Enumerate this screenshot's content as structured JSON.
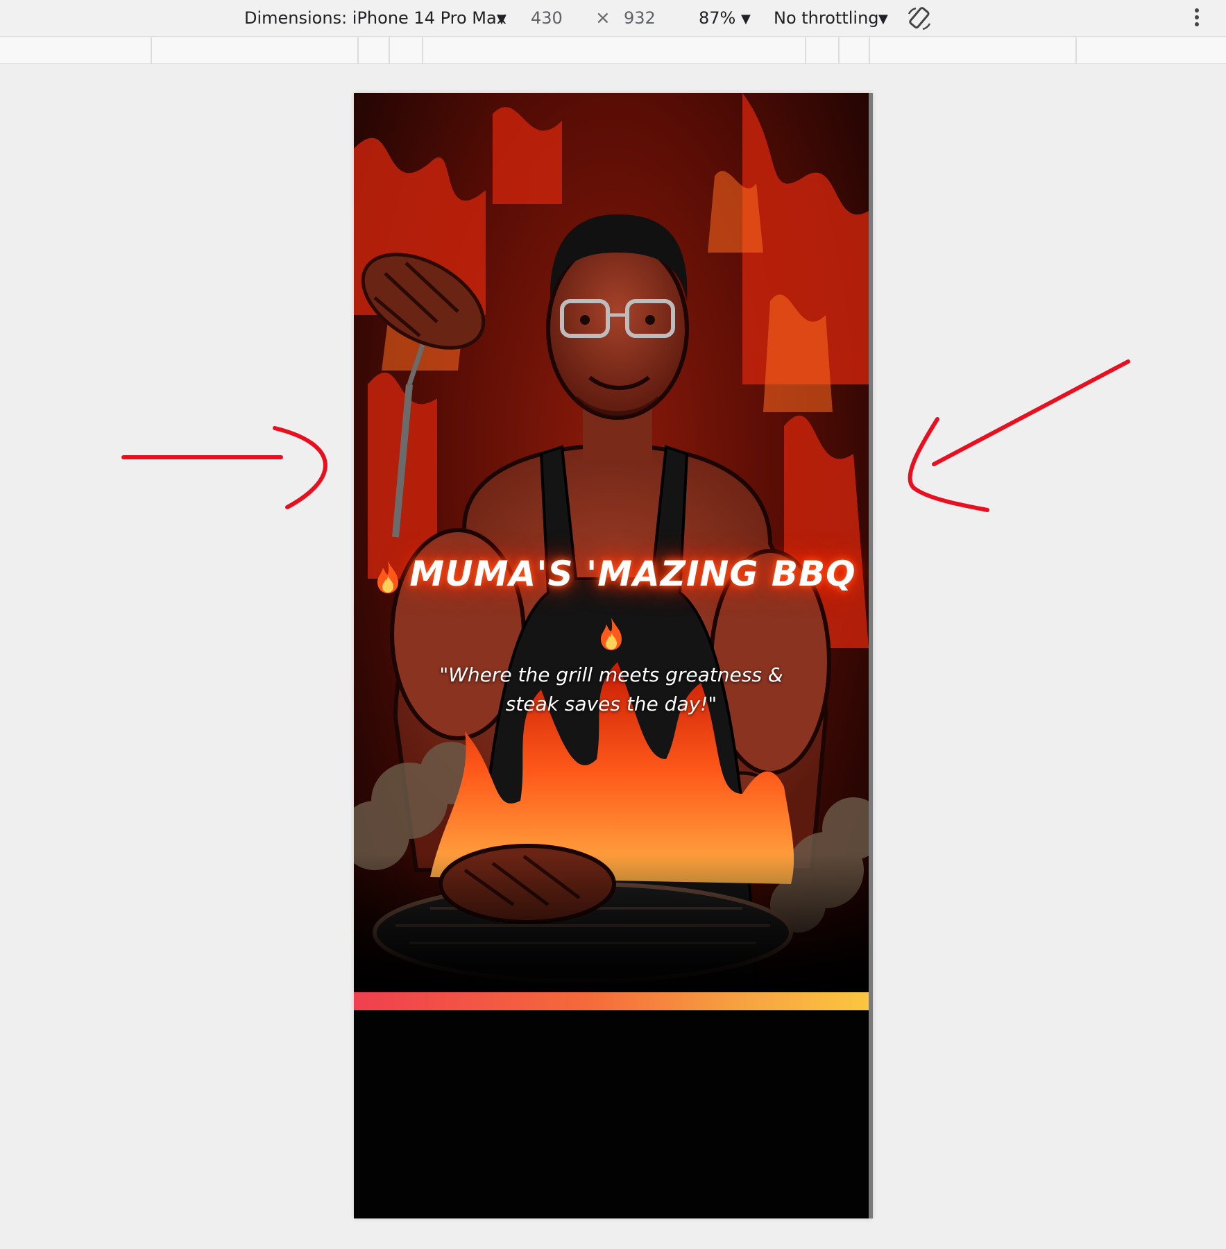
{
  "devtools": {
    "dimensions_label": "Dimensions: iPhone 14 Pro Max",
    "width": "430",
    "times": "×",
    "height": "932",
    "zoom": "87%",
    "throttling": "No throttling",
    "dropdown_arrow": "▼",
    "icons": [
      "rotate-icon",
      "more-options-icon"
    ]
  },
  "hero": {
    "title": "MUMA'S 'MAZING BBQ",
    "tagline": "\"Where the grill meets greatness & steak saves the day!\"",
    "scroll_indicator": "down-arrow-icon"
  },
  "colors": {
    "annotation": "#e8101f",
    "glow": "#ff3b00",
    "bar_start": "#f0404f",
    "bar_end": "#fbc640"
  }
}
